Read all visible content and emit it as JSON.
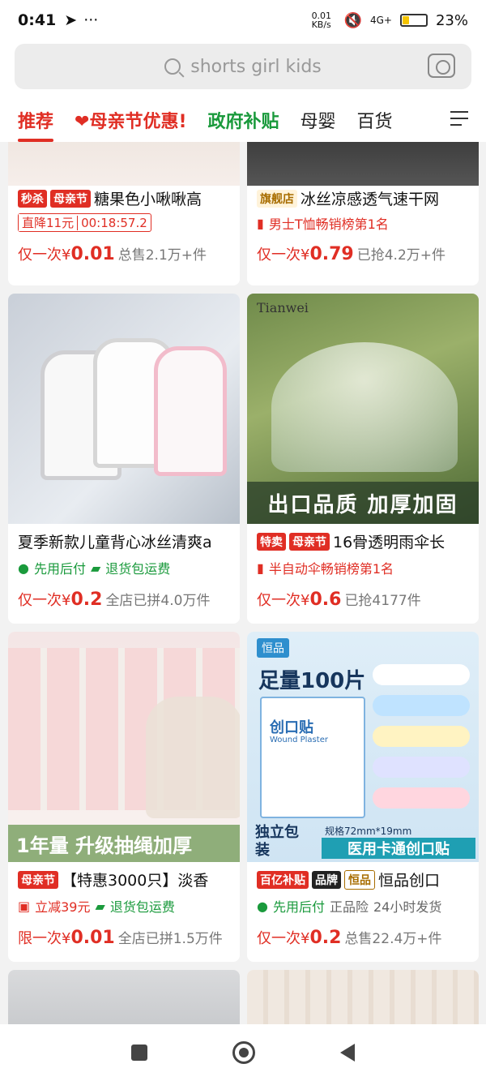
{
  "status": {
    "time": "0:41",
    "net": "0.01 KB/s",
    "signal": "4G+",
    "battery": "23%"
  },
  "search": {
    "placeholder": "shorts girl kids"
  },
  "tabs": [
    "推荐",
    "❤母亲节优惠!",
    "政府补贴",
    "母婴",
    "百货"
  ],
  "cards": [
    {
      "tags": [
        "秒杀",
        "母亲节"
      ],
      "title": "糖果色小啾啾高",
      "sub": "直降11元",
      "countdown": "00:18:57.2",
      "price_prefix": "仅一次¥",
      "price": "0.01",
      "sold": "总售2.1万+件"
    },
    {
      "tags": [
        "旗舰店"
      ],
      "title": "冰丝凉感透气速干网",
      "sub": "男士T恤畅销榜第1名",
      "price_prefix": "仅一次¥",
      "price": "0.79",
      "sold": "已抢4.2万+件"
    },
    {
      "tags": [],
      "title": "夏季新款儿童背心冰丝清爽a",
      "sub1": "先用后付",
      "sub2": "退货包运费",
      "price_prefix": "仅一次¥",
      "price": "0.2",
      "sold": "全店已拼4.0万件"
    },
    {
      "tags": [
        "特卖",
        "母亲节"
      ],
      "title": "16骨透明雨伞长",
      "overlay": "出口品质 加厚加固",
      "img_brand": "Tianwei",
      "sub": "半自动伞畅销榜第1名",
      "price_prefix": "仅一次¥",
      "price": "0.6",
      "sold": "已抢4177件"
    },
    {
      "tags": [
        "母亲节"
      ],
      "title": "【特惠3000只】淡香",
      "img_text": "1年量 升级抽绳加厚",
      "sub1": "立减39元",
      "sub2": "退货包运费",
      "price_prefix": "限一次¥",
      "price": "0.01",
      "sold": "全店已拼1.5万件"
    },
    {
      "tags": [
        "百亿补贴",
        "品牌",
        "恒品"
      ],
      "title": "恒品创口",
      "img_brand": "恒品",
      "img_head": "足量100片",
      "img_box": "创口贴",
      "img_box_sub": "Wound Plaster",
      "img_foot": "独立包装",
      "img_spec": "规格72mm*19mm",
      "img_band": "医用卡通创口贴",
      "sub1": "先用后付",
      "sub_grey1": "正品险",
      "sub_grey2": "24小时发货",
      "price_prefix": "仅一次¥",
      "price": "0.2",
      "sold": "总售22.4万+件"
    }
  ]
}
